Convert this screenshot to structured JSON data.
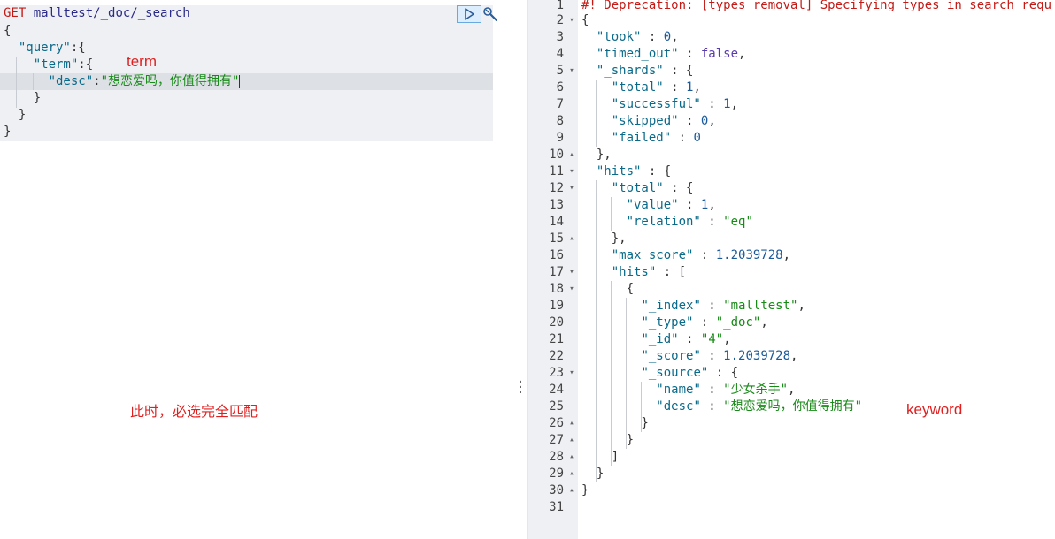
{
  "request": {
    "method": "GET",
    "url": "malltest/_doc/_search",
    "lines": {
      "open": "{",
      "query_key": "\"query\"",
      "term_key": "\"term\"",
      "desc_key": "\"desc\"",
      "desc_value": "\"想恋爱吗，你值得拥有\"",
      "close_inner": "}",
      "close_mid": "}",
      "close_outer": "}"
    },
    "run_button": "run-icon",
    "settings_button": "wrench-icon"
  },
  "annotations": {
    "term": "term",
    "note": "此时，必选完全匹配",
    "keyword": "keyword"
  },
  "response": {
    "line_numbers": [
      "1",
      "2",
      "3",
      "4",
      "5",
      "6",
      "7",
      "8",
      "9",
      "10",
      "11",
      "12",
      "13",
      "14",
      "15",
      "16",
      "17",
      "18",
      "19",
      "20",
      "21",
      "22",
      "23",
      "24",
      "25",
      "26",
      "27",
      "28",
      "29",
      "30",
      "31"
    ],
    "deprecation": "#! Deprecation: [types removal] Specifying types in search requ",
    "took": "0",
    "timed_out": "false",
    "shards": {
      "total": "1",
      "successful": "1",
      "skipped": "0",
      "failed": "0"
    },
    "hits_total": {
      "value": "1",
      "relation": "\"eq\""
    },
    "max_score": "1.2039728",
    "hit": {
      "index": "\"malltest\"",
      "type": "\"_doc\"",
      "id": "\"4\"",
      "score": "1.2039728",
      "source_name": "\"少女杀手\"",
      "source_desc": "\"想恋爱吗，你值得拥有\""
    }
  },
  "colors": {
    "comment": "#c41a16",
    "key": "#0a6a8a",
    "string": "#178a17",
    "annotation": "#e02020",
    "gutter": "#eef0f3"
  }
}
